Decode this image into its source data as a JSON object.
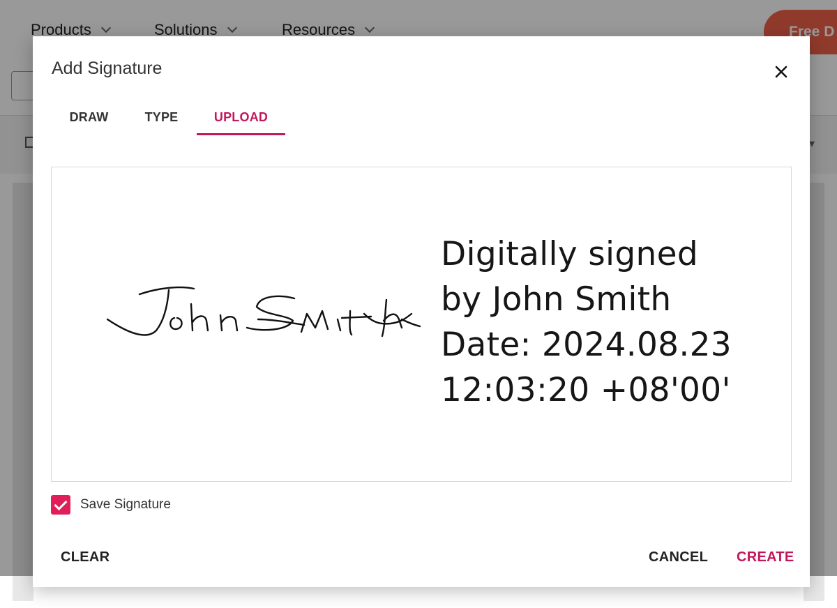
{
  "background": {
    "nav_items": [
      "Products",
      "Solutions",
      "Resources"
    ],
    "cta_label": "Free D"
  },
  "modal": {
    "title": "Add Signature",
    "close_icon": "close-icon",
    "tabs": [
      {
        "label": "DRAW",
        "active": false
      },
      {
        "label": "TYPE",
        "active": false
      },
      {
        "label": "UPLOAD",
        "active": true
      }
    ],
    "accent_color": "#c2185b",
    "preview": {
      "handwritten_signature": "John Smith",
      "stamp_lines": [
        "Digitally signed",
        "by John Smith",
        "Date: 2024.08.23",
        "12:03:20 +08'00'"
      ]
    },
    "save_signature": {
      "label": "Save Signature",
      "checked": true,
      "color": "#e01e5a"
    },
    "buttons": {
      "clear": "CLEAR",
      "cancel": "CANCEL",
      "create": "CREATE"
    }
  }
}
